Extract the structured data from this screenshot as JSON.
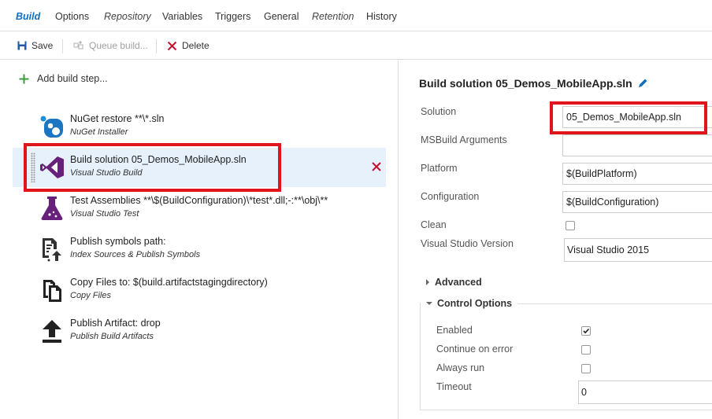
{
  "tabs": [
    {
      "label": "Build"
    },
    {
      "label": "Options"
    },
    {
      "label": "Repository"
    },
    {
      "label": "Variables"
    },
    {
      "label": "Triggers"
    },
    {
      "label": "General"
    },
    {
      "label": "Retention"
    },
    {
      "label": "History"
    }
  ],
  "toolbar": {
    "save_label": "Save",
    "queue_label": "Queue build...",
    "delete_label": "Delete"
  },
  "steps_panel": {
    "add_label": "Add build step...",
    "steps": [
      {
        "title": "NuGet restore **\\*.sln",
        "subtitle": "NuGet Installer",
        "icon": "nuget-icon"
      },
      {
        "title": "Build solution 05_Demos_MobileApp.sln",
        "subtitle": "Visual Studio Build",
        "icon": "visual-studio-icon",
        "selected": true
      },
      {
        "title": "Test Assemblies **\\$(BuildConfiguration)\\*test*.dll;-:**\\obj\\**",
        "subtitle": "Visual Studio Test",
        "icon": "flask-icon"
      },
      {
        "title": "Publish symbols path:",
        "subtitle": "Index Sources & Publish Symbols",
        "icon": "publish-symbols-icon"
      },
      {
        "title": "Copy Files to: $(build.artifactstagingdirectory)",
        "subtitle": "Copy Files",
        "icon": "copy-files-icon"
      },
      {
        "title": "Publish Artifact: drop",
        "subtitle": "Publish Build Artifacts",
        "icon": "upload-arrow-icon"
      }
    ]
  },
  "details": {
    "title": "Build solution 05_Demos_MobileApp.sln",
    "fields": {
      "solution": {
        "label": "Solution",
        "value": "05_Demos_MobileApp.sln"
      },
      "msbuild_args": {
        "label": "MSBuild Arguments",
        "value": ""
      },
      "platform": {
        "label": "Platform",
        "value": "$(BuildPlatform)"
      },
      "configuration": {
        "label": "Configuration",
        "value": "$(BuildConfiguration)"
      },
      "clean": {
        "label": "Clean",
        "checked": false
      },
      "vs_version": {
        "label": "Visual Studio Version",
        "value": "Visual Studio 2015"
      }
    },
    "advanced_label": "Advanced",
    "control_options": {
      "label": "Control Options",
      "enabled": {
        "label": "Enabled",
        "checked": true
      },
      "continue_on_error": {
        "label": "Continue on error",
        "checked": false
      },
      "always_run": {
        "label": "Always run",
        "checked": false
      },
      "timeout": {
        "label": "Timeout",
        "value": "0"
      }
    }
  },
  "colors": {
    "accent": "#106ebe",
    "highlight_border": "#e1141b",
    "selected_row": "#e6f1fb",
    "vs_purple": "#68217a",
    "add_green": "#3b9a3b"
  }
}
